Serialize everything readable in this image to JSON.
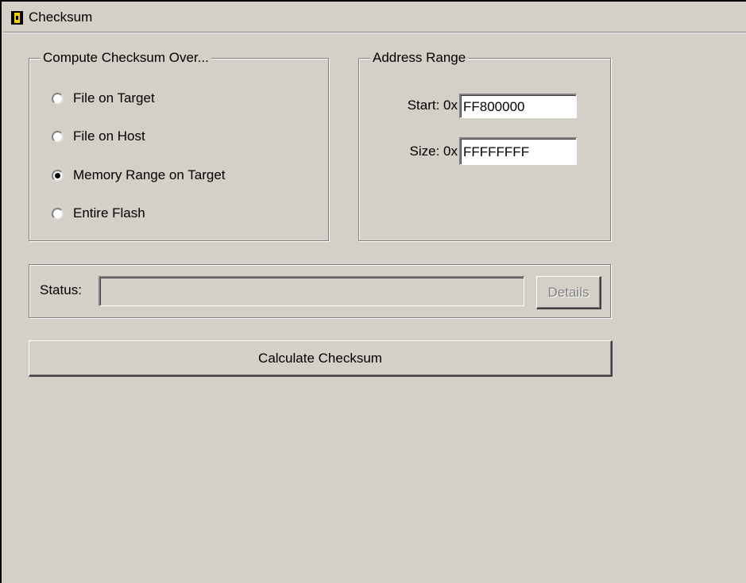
{
  "window": {
    "title": "Checksum",
    "icon": "app-logo-icon"
  },
  "compute_group": {
    "legend": "Compute Checksum Over...",
    "options": [
      {
        "label": "File on Target",
        "checked": false
      },
      {
        "label": "File on Host",
        "checked": false
      },
      {
        "label": "Memory Range on Target",
        "checked": true
      },
      {
        "label": "Entire Flash",
        "checked": false
      }
    ]
  },
  "address_group": {
    "legend": "Address Range",
    "start_label": "Start: 0x",
    "start_value": "FF800000",
    "size_label": "Size: 0x",
    "size_value": "FFFFFFFF"
  },
  "status": {
    "label": "Status:",
    "value": "",
    "details_label": "Details"
  },
  "actions": {
    "calculate_label": "Calculate Checksum"
  }
}
